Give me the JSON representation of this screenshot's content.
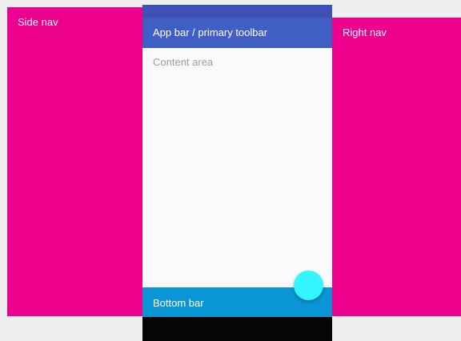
{
  "side_nav": {
    "label": "Side nav"
  },
  "right_nav": {
    "label": "Right nav"
  },
  "phone": {
    "app_bar_label": "App bar / primary toolbar",
    "content_label": "Content area",
    "bottom_bar_label": "Bottom bar"
  },
  "colors": {
    "nav": "#ec008c",
    "status_bar": "#3f51b5",
    "app_bar": "#3f5fc4",
    "content": "#fafafa",
    "bottom_bar": "#0a95d6",
    "nav_strip": "#050505",
    "fab": "#33f5ff",
    "background": "#efefef"
  }
}
